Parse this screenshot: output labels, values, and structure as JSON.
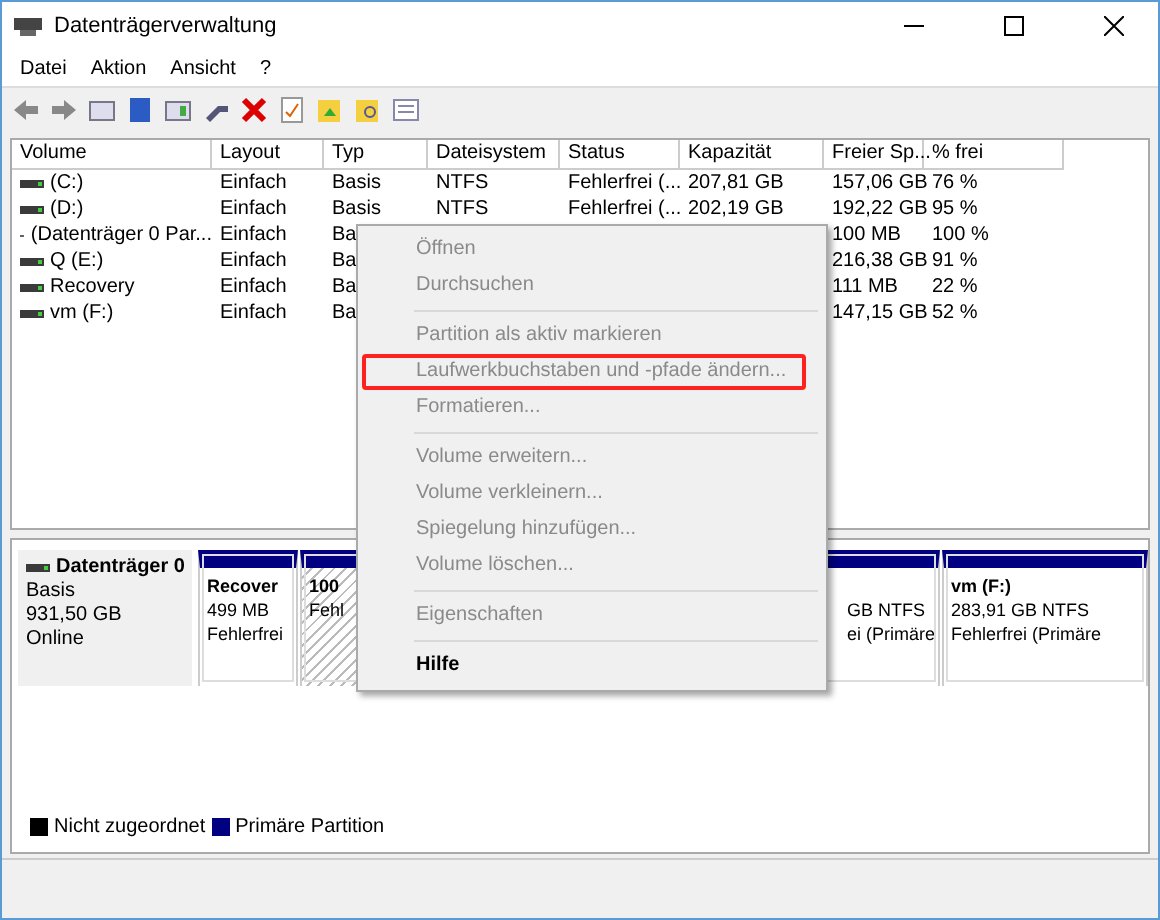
{
  "window": {
    "title": "Datenträgerverwaltung"
  },
  "menu_bar": [
    "Datei",
    "Aktion",
    "Ansicht",
    "?"
  ],
  "table": {
    "columns": [
      "Volume",
      "Layout",
      "Typ",
      "Dateisystem",
      "Status",
      "Kapazität",
      "Freier Sp...",
      "% frei"
    ],
    "rows": [
      [
        "(C:)",
        "Einfach",
        "Basis",
        "NTFS",
        "Fehlerfrei (...",
        "207,81 GB",
        "157,06 GB",
        "76 %"
      ],
      [
        "(D:)",
        "Einfach",
        "Basis",
        "NTFS",
        "Fehlerfrei (...",
        "202,19 GB",
        "192,22 GB",
        "95 %"
      ],
      [
        "(Datenträger 0 Par...",
        "Einfach",
        "Ba",
        "",
        "",
        "",
        "100 MB",
        "100 %"
      ],
      [
        "Q (E:)",
        "Einfach",
        "Ba",
        "",
        "",
        "",
        "216,38 GB",
        "91 %"
      ],
      [
        "Recovery",
        "Einfach",
        "Ba",
        "",
        "",
        "",
        "111 MB",
        "22 %"
      ],
      [
        "vm (F:)",
        "Einfach",
        "Ba",
        "",
        "",
        "",
        "147,15 GB",
        "52 %"
      ]
    ]
  },
  "disk": {
    "name": "Datenträger 0",
    "type": "Basis",
    "size": "931,50 GB",
    "state": "Online",
    "partitions": [
      {
        "selected": false,
        "lines": [
          "Recover",
          "499 MB",
          "Fehlerfrei"
        ]
      },
      {
        "selected": true,
        "lines": [
          "100",
          "Fehl"
        ]
      },
      {
        "selected": false,
        "lines": [
          "GB NTFS",
          "ei (Primäre"
        ]
      },
      {
        "selected": false,
        "lines": [
          "vm  (F:)",
          "283,91 GB NTFS",
          "Fehlerfrei (Primäre"
        ]
      }
    ]
  },
  "legend": [
    {
      "label": "Nicht zugeordnet",
      "color": "#000000"
    },
    {
      "label": "Primäre Partition",
      "color": "#000080"
    }
  ],
  "context_menu": [
    {
      "kind": "item",
      "label": "Öffnen",
      "disabled": true,
      "highlighted": false
    },
    {
      "kind": "item",
      "label": "Durchsuchen",
      "disabled": true,
      "highlighted": false
    },
    {
      "kind": "separator"
    },
    {
      "kind": "item",
      "label": "Partition als aktiv markieren",
      "disabled": true,
      "highlighted": false
    },
    {
      "kind": "item",
      "label": "Laufwerkbuchstaben und -pfade ändern...",
      "disabled": true,
      "highlighted": true
    },
    {
      "kind": "item",
      "label": "Formatieren...",
      "disabled": true,
      "highlighted": false
    },
    {
      "kind": "separator"
    },
    {
      "kind": "item",
      "label": "Volume erweitern...",
      "disabled": true,
      "highlighted": false
    },
    {
      "kind": "item",
      "label": "Volume verkleinern...",
      "disabled": true,
      "highlighted": false
    },
    {
      "kind": "item",
      "label": "Spiegelung hinzufügen...",
      "disabled": true,
      "highlighted": false
    },
    {
      "kind": "item",
      "label": "Volume löschen...",
      "disabled": true,
      "highlighted": false
    },
    {
      "kind": "separator"
    },
    {
      "kind": "item",
      "label": "Eigenschaften",
      "disabled": true,
      "highlighted": false
    },
    {
      "kind": "separator"
    },
    {
      "kind": "item",
      "label": "Hilfe",
      "disabled": false,
      "highlighted": false
    }
  ]
}
